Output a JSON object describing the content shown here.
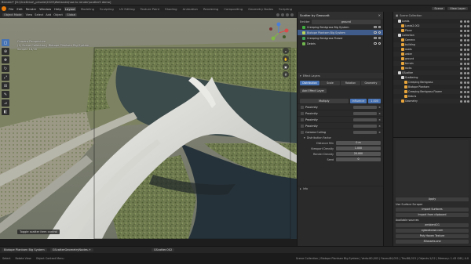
{
  "window": {
    "title": "Blender* [D:\\OneDrive\\_private\\2023\\Wetlands\\how to render\\scatter5 demo]"
  },
  "menubar": {
    "menus": [
      "File",
      "Edit",
      "Render",
      "Window",
      "Help"
    ],
    "workspaces": [
      "Layout",
      "Modeling",
      "Sculpting",
      "UV Editing",
      "Texture Paint",
      "Shading",
      "Animation",
      "Rendering",
      "Compositing",
      "Geometry Nodes",
      "Scripting"
    ],
    "active_workspace": "Layout",
    "scene": "Scene",
    "view_layer": "View Layer"
  },
  "viewport_header": {
    "mode": "Object Mode",
    "menus": [
      "View",
      "Select",
      "Add",
      "Object"
    ],
    "orientation": "Global"
  },
  "viewport": {
    "overlay_line1": "Camera Perspective",
    "overlay_line2": "(1) Scene Collection | Biotope Plantsen Big System",
    "overlay_line3": "Sample 16/16",
    "toast": "Toggle scatter item control"
  },
  "scatter_panel": {
    "title": "Scatter by Geoscatt",
    "target_label": "Emitter",
    "target_value": "ground",
    "systems": [
      {
        "name": "Creeping Bentgrass Big System",
        "color": "#3fae3f",
        "selected": false
      },
      {
        "name": "Biotope Plantsen Big System",
        "color": "#b7d35a",
        "selected": true
      },
      {
        "name": "Creeping Bentgrass Flower",
        "color": "#3ea05c",
        "selected": false
      },
      {
        "name": "Debris",
        "color": "#70b84e",
        "selected": false
      }
    ],
    "effect_layers_title": "Effect Layers",
    "tabs": [
      "Distribution",
      "Scale",
      "Rotation",
      "Geometry"
    ],
    "add_layer_label": "Add Effect Layer",
    "blend_mode": "Multiply",
    "influence_label": "Influence",
    "influence_value": "1.000",
    "layers": [
      {
        "name": "Proximity"
      },
      {
        "name": "Proximity"
      },
      {
        "name": "Proximity"
      },
      {
        "name": "Proximity"
      },
      {
        "name": "Camera Culling"
      }
    ],
    "distribution_title": "Distribution Factor",
    "fields": [
      {
        "label": "Distance Min",
        "value": "0 m",
        "blue": false
      },
      {
        "label": "Viewport Density",
        "value": "1.000",
        "blue": false
      },
      {
        "label": "Render Density",
        "value": "20.000",
        "blue": false
      },
      {
        "label": "Seed",
        "value": "0",
        "blue": false
      }
    ],
    "info_label": "Info"
  },
  "outliner": {
    "root": "Scene Collection",
    "items": [
      {
        "name": "Lands",
        "color": "#d7d7d7",
        "depth": 1
      },
      {
        "name": "Lands2.002",
        "color": "#e8a53b",
        "depth": 2
      },
      {
        "name": "Plane",
        "color": "#e8a53b",
        "depth": 2
      },
      {
        "name": "Collection",
        "color": "#d7d7d7",
        "depth": 1
      },
      {
        "name": "Camera",
        "color": "#e8a53b",
        "depth": 2
      },
      {
        "name": "building",
        "color": "#e8a53b",
        "depth": 2
      },
      {
        "name": "roads",
        "color": "#e8a53b",
        "depth": 2
      },
      {
        "name": "water",
        "color": "#e8a53b",
        "depth": 2
      },
      {
        "name": "ground",
        "color": "#e8a53b",
        "depth": 2
      },
      {
        "name": "terrain",
        "color": "#e8a53b",
        "depth": 2
      },
      {
        "name": "rocks",
        "color": "#e8a53b",
        "depth": 2
      },
      {
        "name": "GScatter",
        "color": "#d7d7d7",
        "depth": 1
      },
      {
        "name": "Scattering",
        "color": "#d7d7d7",
        "depth": 2
      },
      {
        "name": "Creeping Bentgrass",
        "color": "#e8a53b",
        "depth": 3
      },
      {
        "name": "Biotope Plantsen",
        "color": "#e8a53b",
        "depth": 3
      },
      {
        "name": "Creeping Bentgrass Flower",
        "color": "#e8a53b",
        "depth": 3
      },
      {
        "name": "Debris",
        "color": "#e8a53b",
        "depth": 3
      },
      {
        "name": "Geometry",
        "color": "#e8a53b",
        "depth": 2
      }
    ]
  },
  "properties": {
    "ok_label": "Apply",
    "surface_title": "Use Surface Scraper",
    "buttons": [
      "Import Surfaces",
      "Import from clipboard"
    ],
    "sources_title": "Available sources",
    "sources": [
      "ambientCG",
      "cgbookcase.com",
      "Poly Haven Texture",
      "3Dassets.one"
    ]
  },
  "node_bar": {
    "items": [
      "Biotope Plantsen Big System",
      "GScatterGeometryNodes.+"
    ],
    "right_item": "GScatter.002"
  },
  "status_bar": {
    "left": [
      "Select",
      "Rotate View",
      "Object Context Menu"
    ],
    "right": "Scene Collection | Biotope Plantsen Big System | Verts:80,002 | Faces:84,051 | Tris:88,023 | Objects:1/12 | Memory: 1.43 GiB | 4.0"
  }
}
